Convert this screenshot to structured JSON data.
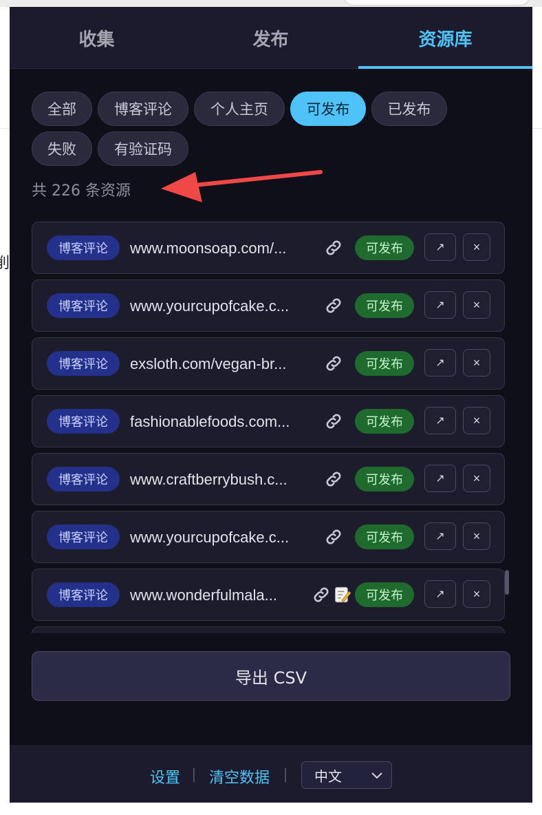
{
  "background": {
    "edge_glyph": "削"
  },
  "tabs": [
    {
      "label": "收集",
      "active": false
    },
    {
      "label": "发布",
      "active": false
    },
    {
      "label": "资源库",
      "active": true
    }
  ],
  "filters": [
    {
      "label": "全部",
      "active": false
    },
    {
      "label": "博客评论",
      "active": false
    },
    {
      "label": "个人主页",
      "active": false
    },
    {
      "label": "可发布",
      "active": true
    },
    {
      "label": "已发布",
      "active": false
    },
    {
      "label": "失败",
      "active": false
    },
    {
      "label": "有验证码",
      "active": false
    }
  ],
  "count_text": "共 226 条资源",
  "resources": [
    {
      "type": "博客评论",
      "url": "www.moonsoap.com/...",
      "icons": [
        "link-icon"
      ],
      "status": "可发布"
    },
    {
      "type": "博客评论",
      "url": "www.yourcupofcake.c...",
      "icons": [
        "link-icon"
      ],
      "status": "可发布"
    },
    {
      "type": "博客评论",
      "url": "exsloth.com/vegan-br...",
      "icons": [
        "link-icon"
      ],
      "status": "可发布"
    },
    {
      "type": "博客评论",
      "url": "fashionablefoods.com...",
      "icons": [
        "link-icon"
      ],
      "status": "可发布"
    },
    {
      "type": "博客评论",
      "url": "www.craftberrybush.c...",
      "icons": [
        "link-icon"
      ],
      "status": "可发布"
    },
    {
      "type": "博客评论",
      "url": "www.yourcupofcake.c...",
      "icons": [
        "link-icon"
      ],
      "status": "可发布"
    },
    {
      "type": "博客评论",
      "url": "www.wonderfulmala...",
      "icons": [
        "link-icon",
        "memo-icon"
      ],
      "status": "可发布"
    }
  ],
  "row_actions": {
    "open_icon": "↗",
    "delete_icon": "×"
  },
  "export_label": "导出 CSV",
  "footer": {
    "settings_label": "设置",
    "separator": "|",
    "clear_label": "清空数据",
    "language_value": "中文"
  },
  "colors": {
    "accent": "#4fc3f7",
    "status_green": "#1f6b2e",
    "tag_blue": "#24318a",
    "annotation_arrow": "#f04747"
  }
}
